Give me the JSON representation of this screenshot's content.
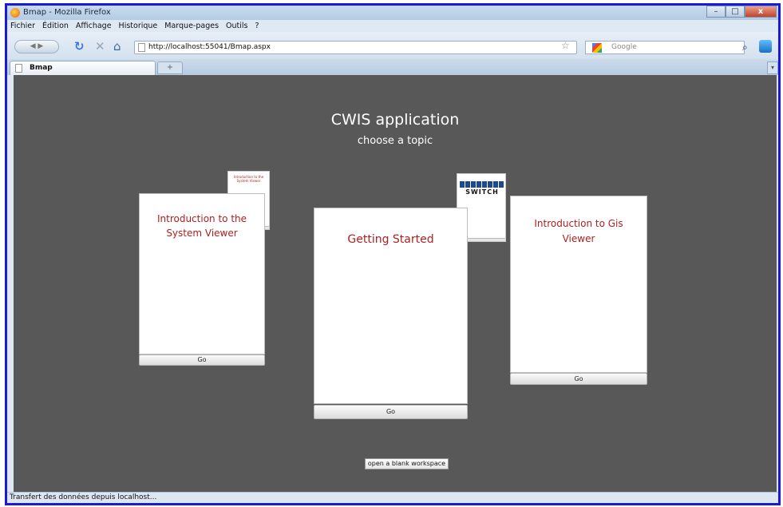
{
  "window": {
    "title": "Bmap - Mozilla Firefox",
    "controls": {
      "minimize": "–",
      "maximize": "□",
      "close": "x"
    }
  },
  "menu": {
    "items": [
      "Fichier",
      "Édition",
      "Affichage",
      "Historique",
      "Marque-pages",
      "Outils",
      "?"
    ]
  },
  "nav": {
    "url": "http://localhost:55041/Bmap.aspx",
    "search_placeholder": "Google",
    "reload_icon": "↻",
    "stop_icon": "✕",
    "home_icon": "⌂",
    "star_icon": "☆",
    "search_icon": "⌕"
  },
  "tabs": {
    "active_label": "Bmap",
    "new_tab_symbol": "+"
  },
  "page": {
    "title": "CWIS application",
    "subtitle": "choose a topic",
    "cards": [
      {
        "title": "Introduction to the System Viewer",
        "go_label": "Go"
      },
      {
        "title": "Getting Started",
        "go_label": "Go"
      },
      {
        "title": "Introduction to Gis Viewer",
        "go_label": "Go"
      }
    ],
    "thumbs": {
      "intro_text": "Introduction to the System Viewer",
      "switch_logo": "SWITCH"
    },
    "blank_workspace_label": "open a blank workspace"
  },
  "status": {
    "text": "Transfert des données depuis localhost..."
  },
  "colors": {
    "content_bg": "#585858",
    "card_title": "#b01e1e",
    "frame_border": "#1a1adb"
  }
}
